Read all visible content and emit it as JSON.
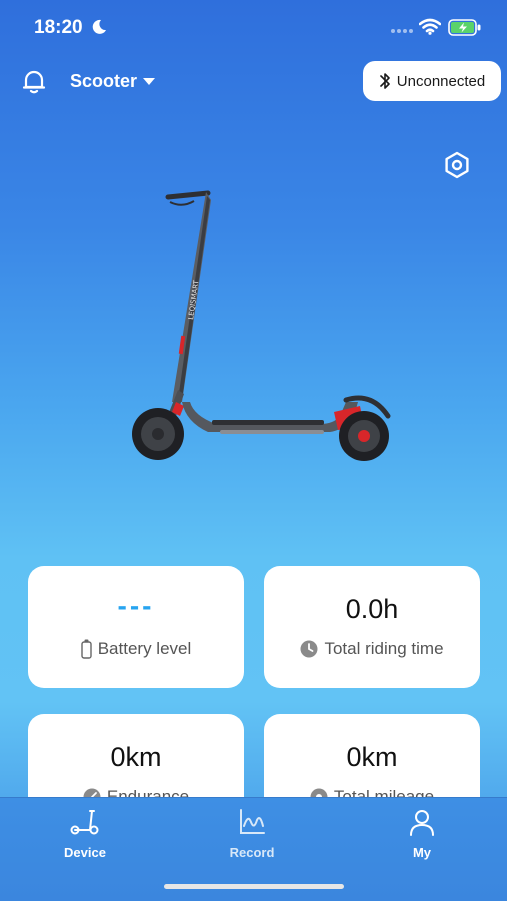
{
  "status_bar": {
    "time": "18:20"
  },
  "header": {
    "device_name": "Scooter",
    "connection_status": "Unconnected"
  },
  "colors": {
    "accent": "#27a4f0",
    "brand": "#2f6fdc",
    "card_bg": "#ffffff"
  },
  "stats": [
    {
      "value": "---",
      "label": "Battery level",
      "icon": "battery-outline-icon"
    },
    {
      "value": "0.0h",
      "label": "Total riding time",
      "icon": "clock-icon"
    },
    {
      "value": "0km",
      "label": "Endurance",
      "icon": "gauge-icon"
    },
    {
      "value": "0km",
      "label": "Total mileage",
      "icon": "odometer-icon"
    }
  ],
  "tabs": [
    {
      "label": "Device",
      "icon": "scooter-icon"
    },
    {
      "label": "Record",
      "icon": "chart-line-icon"
    },
    {
      "label": "My",
      "icon": "person-icon"
    }
  ]
}
